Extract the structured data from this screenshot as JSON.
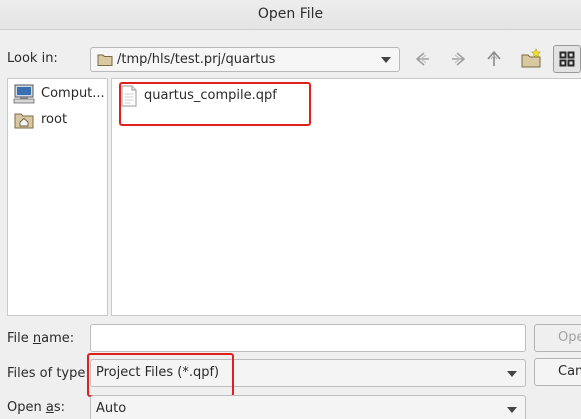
{
  "window": {
    "title": "Open File"
  },
  "lookin": {
    "label": "Look in:",
    "path": "/tmp/hls/test.prj/quartus"
  },
  "toolbar": {
    "back_icon": "back-arrow-icon",
    "forward_icon": "forward-arrow-icon",
    "up_icon": "up-arrow-icon",
    "new_folder_icon": "new-folder-icon",
    "detail_view_icon": "grid-view-icon"
  },
  "sidebar": {
    "items": [
      {
        "label": "Comput...",
        "icon": "computer-icon"
      },
      {
        "label": "root",
        "icon": "home-folder-icon"
      }
    ]
  },
  "files": [
    {
      "name": "quartus_compile.qpf",
      "icon": "document-icon"
    }
  ],
  "filename": {
    "label_pre": "File ",
    "label_u": "n",
    "label_post": "ame:",
    "value": ""
  },
  "filetype": {
    "label": "Files of type:",
    "value": "Project Files (*.qpf)"
  },
  "openas": {
    "label_pre": "Open ",
    "label_u": "a",
    "label_post": "s:",
    "value": "Auto"
  },
  "buttons": {
    "open": "Open",
    "cancel": "Cancel"
  },
  "colors": {
    "highlight": "#e0201e",
    "background": "#efefef"
  }
}
